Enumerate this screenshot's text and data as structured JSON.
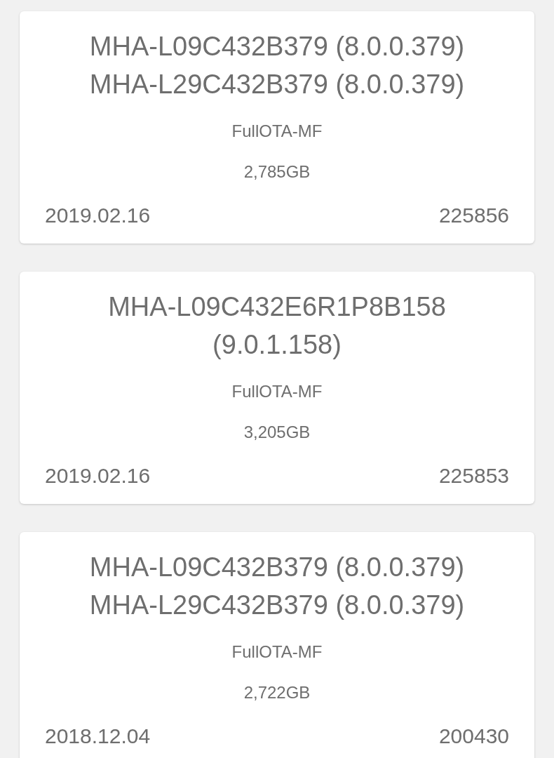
{
  "firmware_cards": [
    {
      "titles": [
        "MHA-L09C432B379 (8.0.0.379)",
        "MHA-L29C432B379 (8.0.0.379)"
      ],
      "package_type": "FullOTA-MF",
      "size": "2,785GB",
      "date": "2019.02.16",
      "id": "225856"
    },
    {
      "titles": [
        "MHA-L09C432E6R1P8B158 (9.0.1.158)"
      ],
      "package_type": "FullOTA-MF",
      "size": "3,205GB",
      "date": "2019.02.16",
      "id": "225853"
    },
    {
      "titles": [
        "MHA-L09C432B379 (8.0.0.379)",
        "MHA-L29C432B379 (8.0.0.379)"
      ],
      "package_type": "FullOTA-MF",
      "size": "2,722GB",
      "date": "2018.12.04",
      "id": "200430"
    }
  ]
}
